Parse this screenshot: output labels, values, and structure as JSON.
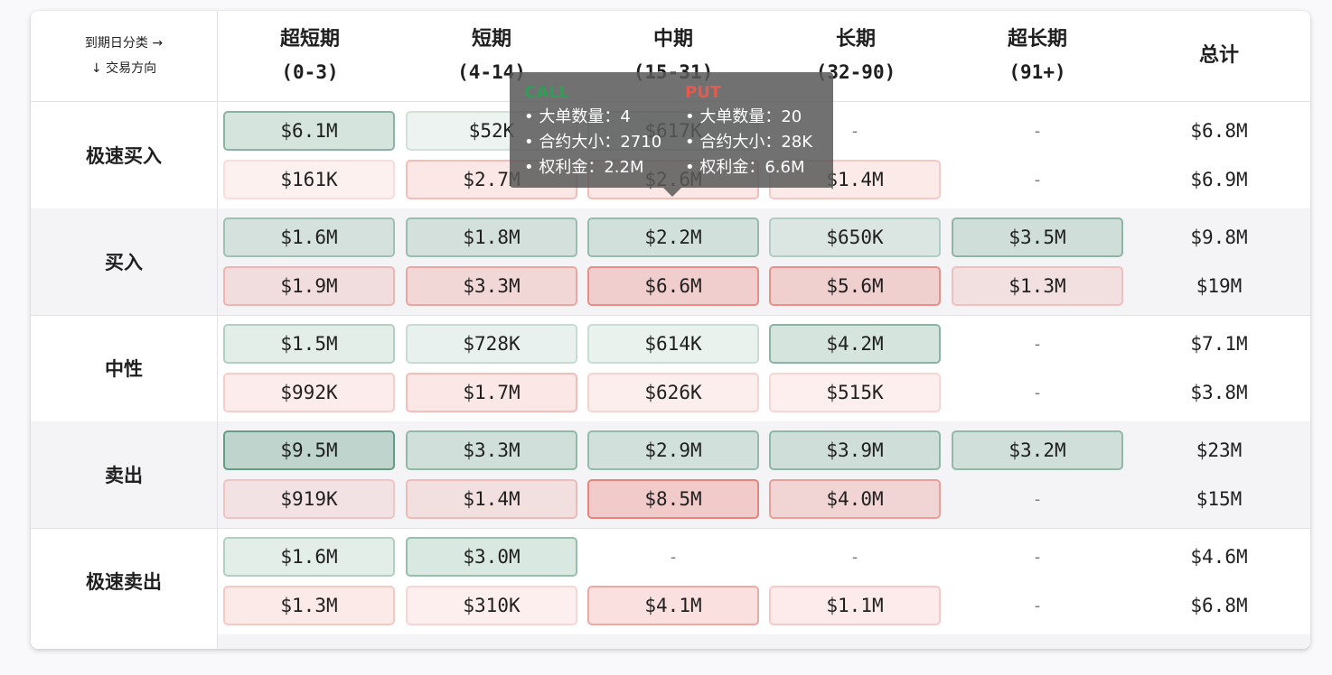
{
  "header": {
    "corner_top": "到期日分类 →",
    "corner_bottom": "↓ 交易方向",
    "columns": [
      {
        "name": "超短期",
        "range": "(0-3)"
      },
      {
        "name": "短期",
        "range": "(4-14)"
      },
      {
        "name": "中期",
        "range": "(15-31)"
      },
      {
        "name": "长期",
        "range": "(32-90)"
      },
      {
        "name": "超长期",
        "range": "(91+)"
      },
      {
        "name": "总计",
        "range": ""
      }
    ]
  },
  "colors": {
    "call_accent": "#2e9e57",
    "put_accent": "#e55a4f",
    "call_fill": "#dbe8e3",
    "put_fill": "#fae6e6"
  },
  "rows": [
    {
      "label": "极速买入",
      "call": [
        {
          "v": "$6.1M",
          "level": 0.55
        },
        {
          "v": "$52K",
          "level": 0.05
        },
        {
          "v": "$617K",
          "level": 0.1
        },
        {
          "v": "-",
          "level": 0
        },
        {
          "v": "-",
          "level": 0
        }
      ],
      "call_total": "$6.8M",
      "put": [
        {
          "v": "$161K",
          "level": 0.03
        },
        {
          "v": "$2.7M",
          "level": 0.3
        },
        {
          "v": "$2.6M",
          "level": 0.3
        },
        {
          "v": "$1.4M",
          "level": 0.2
        },
        {
          "v": "-",
          "level": 0
        }
      ],
      "put_total": "$6.9M"
    },
    {
      "label": "买入",
      "call": [
        {
          "v": "$1.6M",
          "level": 0.35
        },
        {
          "v": "$1.8M",
          "level": 0.38
        },
        {
          "v": "$2.2M",
          "level": 0.42
        },
        {
          "v": "$650K",
          "level": 0.2
        },
        {
          "v": "$3.5M",
          "level": 0.5
        }
      ],
      "call_total": "$9.8M",
      "put": [
        {
          "v": "$1.9M",
          "level": 0.3
        },
        {
          "v": "$3.3M",
          "level": 0.45
        },
        {
          "v": "$6.6M",
          "level": 0.75
        },
        {
          "v": "$5.6M",
          "level": 0.7
        },
        {
          "v": "$1.3M",
          "level": 0.2
        }
      ],
      "put_total": "$19M"
    },
    {
      "label": "中性",
      "call": [
        {
          "v": "$1.5M",
          "level": 0.25
        },
        {
          "v": "$728K",
          "level": 0.12
        },
        {
          "v": "$614K",
          "level": 0.1
        },
        {
          "v": "$4.2M",
          "level": 0.55
        },
        {
          "v": "-",
          "level": 0
        }
      ],
      "call_total": "$7.1M",
      "put": [
        {
          "v": "$992K",
          "level": 0.15
        },
        {
          "v": "$1.7M",
          "level": 0.3
        },
        {
          "v": "$626K",
          "level": 0.1
        },
        {
          "v": "$515K",
          "level": 0.08
        },
        {
          "v": "-",
          "level": 0
        }
      ],
      "put_total": "$3.8M"
    },
    {
      "label": "卖出",
      "call": [
        {
          "v": "$9.5M",
          "level": 0.85
        },
        {
          "v": "$3.3M",
          "level": 0.45
        },
        {
          "v": "$2.9M",
          "level": 0.42
        },
        {
          "v": "$3.9M",
          "level": 0.48
        },
        {
          "v": "$3.2M",
          "level": 0.45
        }
      ],
      "call_total": "$23M",
      "put": [
        {
          "v": "$919K",
          "level": 0.15
        },
        {
          "v": "$1.4M",
          "level": 0.25
        },
        {
          "v": "$8.5M",
          "level": 0.85
        },
        {
          "v": "$4.0M",
          "level": 0.55
        },
        {
          "v": "-",
          "level": 0
        }
      ],
      "put_total": "$15M"
    },
    {
      "label": "极速卖出",
      "call": [
        {
          "v": "$1.6M",
          "level": 0.25
        },
        {
          "v": "$3.0M",
          "level": 0.45
        },
        {
          "v": "-",
          "level": 0
        },
        {
          "v": "-",
          "level": 0
        },
        {
          "v": "-",
          "level": 0
        }
      ],
      "call_total": "$4.6M",
      "put": [
        {
          "v": "$1.3M",
          "level": 0.2
        },
        {
          "v": "$310K",
          "level": 0.08
        },
        {
          "v": "$4.1M",
          "level": 0.5
        },
        {
          "v": "$1.1M",
          "level": 0.18
        },
        {
          "v": "-",
          "level": 0
        }
      ],
      "put_total": "$6.8M"
    }
  ],
  "tooltip": {
    "call_title": "CALL",
    "put_title": "PUT",
    "call_lines": [
      "• 大单数量：4",
      "• 合约大小：2710",
      "• 权利金：2.2M"
    ],
    "put_lines": [
      "• 大单数量：20",
      "• 合约大小：28K",
      "• 权利金：6.6M"
    ]
  }
}
